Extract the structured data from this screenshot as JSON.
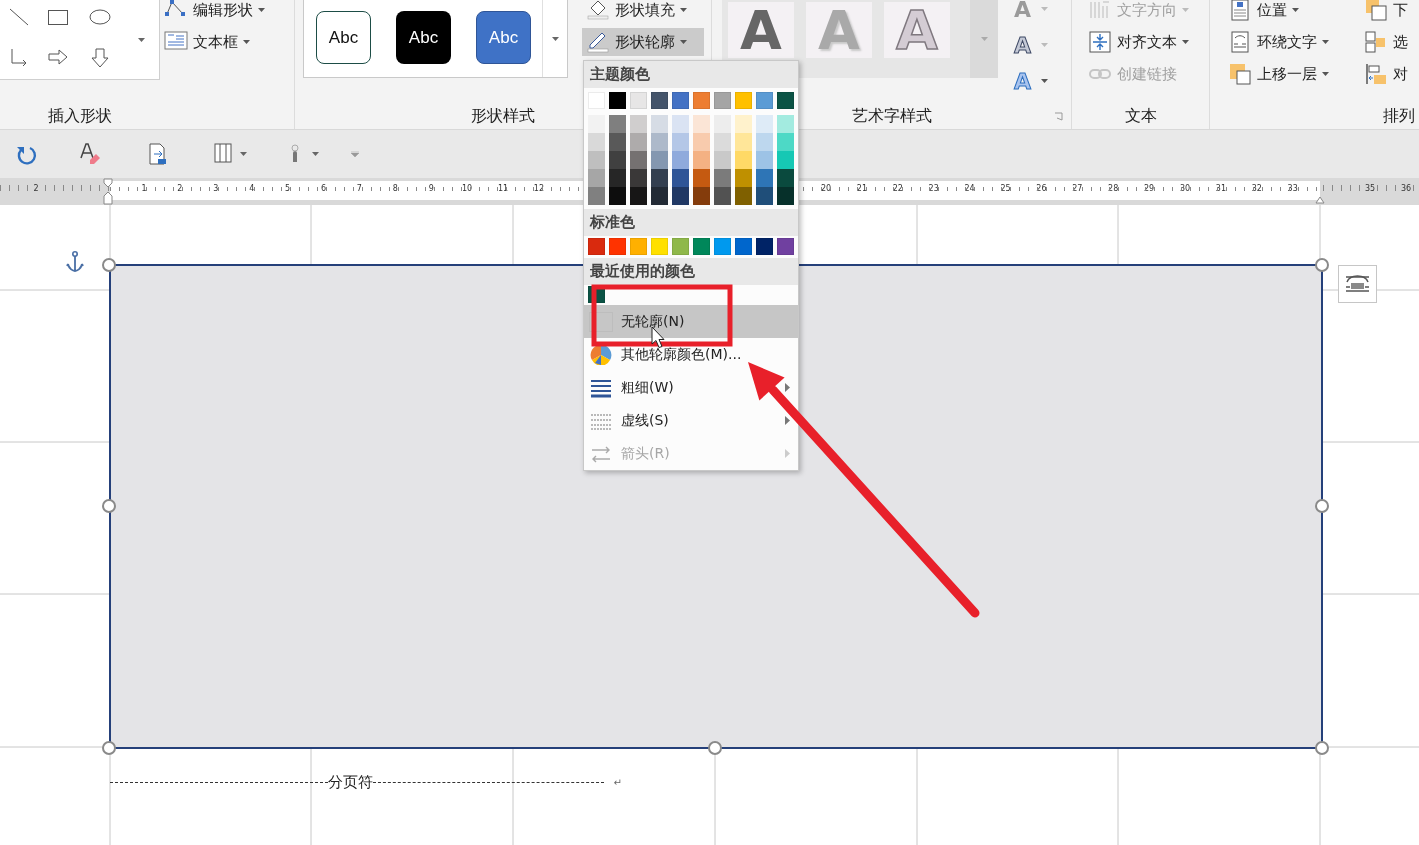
{
  "ribbon": {
    "groups": [
      {
        "kind": "insert_shapes",
        "label": "插入形状",
        "commands": [
          {
            "label": "编辑形状",
            "disabled": false,
            "dropdown": true
          },
          {
            "label": "文本框",
            "disabled": false,
            "dropdown": true
          }
        ]
      },
      {
        "kind": "shape_styles",
        "label": "形状样式",
        "styles": [
          {
            "label": "Abc",
            "kind": "outline"
          },
          {
            "label": "Abc",
            "kind": "dark"
          },
          {
            "label": "Abc",
            "kind": "blue"
          }
        ],
        "commands": [
          {
            "label": "形状填充",
            "disabled": false,
            "pressed": false,
            "dropdown": true
          },
          {
            "label": "形状轮廓",
            "disabled": false,
            "pressed": true,
            "dropdown": true
          }
        ]
      },
      {
        "kind": "wordart",
        "label": "艺术字样式",
        "styles": [
          {
            "label": "A",
            "kind": "dark"
          },
          {
            "label": "A",
            "kind": "shadow"
          },
          {
            "label": "A",
            "kind": "outline"
          }
        ],
        "text_tools": [
          {
            "label": "A",
            "kind": "fill"
          },
          {
            "label": "A",
            "kind": "outline"
          },
          {
            "label": "A",
            "kind": "effects"
          }
        ]
      },
      {
        "kind": "text",
        "label": "文本",
        "commands": [
          {
            "label": "文字方向",
            "disabled": true,
            "dropdown": true
          },
          {
            "label": "对齐文本",
            "disabled": false,
            "dropdown": true
          },
          {
            "label": "创建链接",
            "disabled": true,
            "dropdown": false
          }
        ]
      },
      {
        "kind": "arrange",
        "label": "排列",
        "commands": [
          {
            "label": "位置",
            "disabled": false,
            "dropdown": true
          },
          {
            "label": "环绕文字",
            "disabled": false,
            "dropdown": true
          },
          {
            "label": "上移一层",
            "disabled": false,
            "dropdown": true
          }
        ],
        "more": [
          {
            "label": "下",
            "disabled": false,
            "dropdown": false
          },
          {
            "label": "选",
            "disabled": false,
            "dropdown": false
          },
          {
            "label": "对",
            "disabled": false,
            "dropdown": false
          }
        ]
      }
    ]
  },
  "ruler": {
    "segments": [
      {
        "labels": [
          "2"
        ]
      },
      {
        "labels": [
          "1",
          "2",
          "3",
          "4",
          "5",
          "6",
          "7",
          "8",
          "9",
          "10",
          "11",
          "12"
        ]
      },
      {
        "labels": [
          "20",
          "21",
          "22",
          "23",
          "24",
          "25",
          "26",
          "27",
          "28",
          "29",
          "30",
          "31",
          "32",
          "33"
        ]
      },
      {
        "labels": [
          "35",
          "36"
        ]
      }
    ]
  },
  "document": {
    "shape": {
      "selected": true
    },
    "page_break": "分页符",
    "paragraph_mark": "↵"
  },
  "outline_menu": {
    "theme_title": "主题颜色",
    "theme_colors": [
      {
        "color": "#ffffff",
        "shades": [
          {
            "color": "#f2f2f2"
          },
          {
            "color": "#d9d9d9"
          },
          {
            "color": "#bfbfbf"
          },
          {
            "color": "#a6a6a6"
          },
          {
            "color": "#808080"
          }
        ]
      },
      {
        "color": "#000000",
        "shades": [
          {
            "color": "#7f7f7f"
          },
          {
            "color": "#595959"
          },
          {
            "color": "#404040"
          },
          {
            "color": "#262626"
          },
          {
            "color": "#0d0d0d"
          }
        ]
      },
      {
        "color": "#e7e6e6",
        "shades": [
          {
            "color": "#d0cece"
          },
          {
            "color": "#aeabab"
          },
          {
            "color": "#757171"
          },
          {
            "color": "#3a3838"
          },
          {
            "color": "#171616"
          }
        ]
      },
      {
        "color": "#44546a",
        "shades": [
          {
            "color": "#d6dce5"
          },
          {
            "color": "#adb9ca"
          },
          {
            "color": "#8497b0"
          },
          {
            "color": "#333f50"
          },
          {
            "color": "#222a35"
          }
        ]
      },
      {
        "color": "#4472c4",
        "shades": [
          {
            "color": "#dae3f3"
          },
          {
            "color": "#b4c7e7"
          },
          {
            "color": "#8faadc"
          },
          {
            "color": "#2f5597"
          },
          {
            "color": "#203864"
          }
        ]
      },
      {
        "color": "#ed7d31",
        "shades": [
          {
            "color": "#fbe5d6"
          },
          {
            "color": "#f8cbad"
          },
          {
            "color": "#f4b183"
          },
          {
            "color": "#c55a11"
          },
          {
            "color": "#843c0c"
          }
        ]
      },
      {
        "color": "#a5a5a5",
        "shades": [
          {
            "color": "#ededed"
          },
          {
            "color": "#dbdbdb"
          },
          {
            "color": "#c9c9c9"
          },
          {
            "color": "#7b7b7b"
          },
          {
            "color": "#525252"
          }
        ]
      },
      {
        "color": "#ffc000",
        "shades": [
          {
            "color": "#fff2cc"
          },
          {
            "color": "#ffe699"
          },
          {
            "color": "#ffd966"
          },
          {
            "color": "#bf9000"
          },
          {
            "color": "#7f6000"
          }
        ]
      },
      {
        "color": "#5b9bd5",
        "shades": [
          {
            "color": "#deebf7"
          },
          {
            "color": "#bdd7ee"
          },
          {
            "color": "#9dc3e6"
          },
          {
            "color": "#2e75b6"
          },
          {
            "color": "#1f4e79"
          }
        ]
      },
      {
        "color": "#0b5345",
        "shades": [
          {
            "color": "#a3ebe0"
          },
          {
            "color": "#4dd9c6"
          },
          {
            "color": "#16c8b4"
          },
          {
            "color": "#0a4a3e"
          },
          {
            "color": "#06302a"
          }
        ]
      }
    ],
    "standard_title": "标准色",
    "standard_colors": [
      {
        "color": "#d92a0e"
      },
      {
        "color": "#ff3300"
      },
      {
        "color": "#ffb000"
      },
      {
        "color": "#ffe000"
      },
      {
        "color": "#8fb84a"
      },
      {
        "color": "#00875a"
      },
      {
        "color": "#0099ee"
      },
      {
        "color": "#0066cc"
      },
      {
        "color": "#002366"
      },
      {
        "color": "#7040a0"
      }
    ],
    "recent_title": "最近使用的颜色",
    "recent_colors": [
      {
        "color": "#0b5345"
      }
    ],
    "items": [
      {
        "label": "无轮廓(N)",
        "selected": true,
        "disabled": false,
        "submenu": false
      },
      {
        "label": "其他轮廓颜色(M)...",
        "selected": false,
        "disabled": false,
        "submenu": false
      },
      {
        "label": "粗细(W)",
        "selected": false,
        "disabled": false,
        "submenu": true
      },
      {
        "label": "虚线(S)",
        "selected": false,
        "disabled": false,
        "submenu": true
      },
      {
        "label": "箭头(R)",
        "selected": false,
        "disabled": true,
        "submenu": true
      }
    ]
  }
}
